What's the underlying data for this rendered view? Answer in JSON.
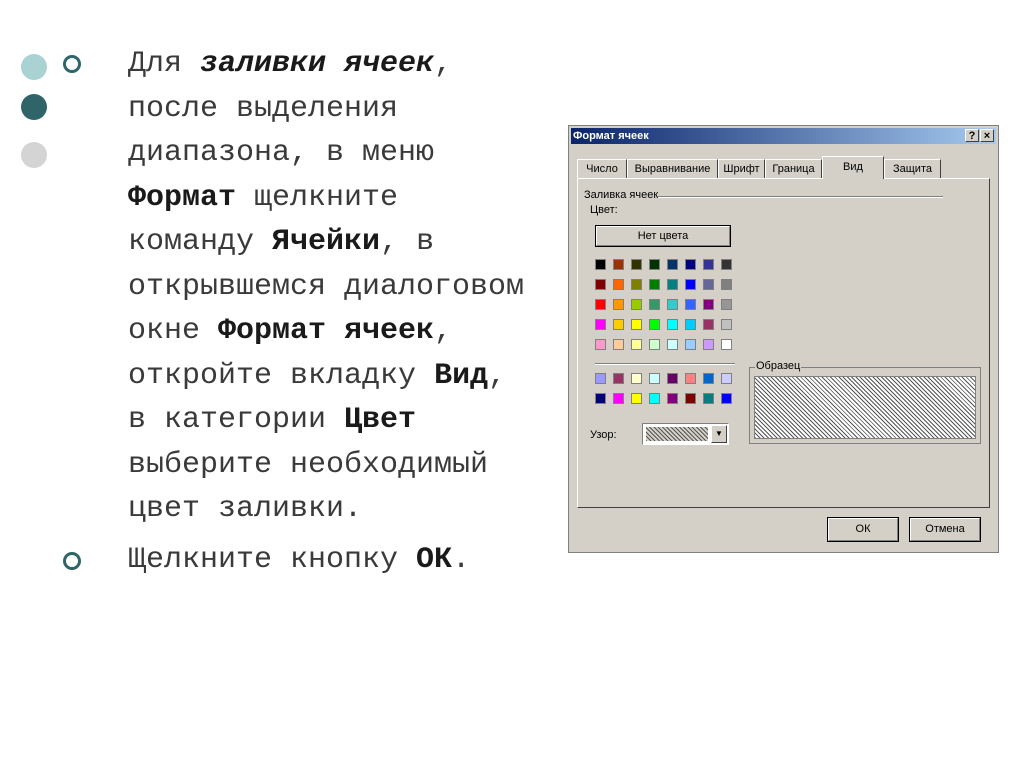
{
  "slide": {
    "bullet1": {
      "t1": "Для ",
      "b1": "заливки ячеек",
      "t2": ", после выделения диапазона, в меню ",
      "b2": "Формат",
      "t3": " щелкните команду ",
      "b3": "Ячейки",
      "t4": ", в открывшемся диалоговом окне ",
      "b4": "Формат ячеек",
      "t5": ", откройте вкладку ",
      "b5": "Вид",
      "t6": ", в категории ",
      "b6": "Цвет",
      "t7": " выберите необходимый цвет заливки."
    },
    "bullet2": {
      "t1": "Щелкните кнопку ",
      "b1": "ОК",
      "t2": "."
    }
  },
  "dialog": {
    "title": "Формат ячеек",
    "help_label": "?",
    "close_label": "×",
    "tabs": [
      {
        "label": "Число"
      },
      {
        "label": "Выравнивание"
      },
      {
        "label": "Шрифт"
      },
      {
        "label": "Граница"
      },
      {
        "label": "Вид"
      },
      {
        "label": "Защита"
      }
    ],
    "active_tab": "Вид",
    "group_label": "Заливка ячеек",
    "color_label": "Цвет:",
    "no_color_button": "Нет цвета",
    "palette_main": [
      "#000000",
      "#993300",
      "#333300",
      "#003300",
      "#003366",
      "#000080",
      "#333399",
      "#333333",
      "#800000",
      "#FF6600",
      "#808000",
      "#008000",
      "#008080",
      "#0000FF",
      "#666699",
      "#808080",
      "#FF0000",
      "#FF9900",
      "#99CC00",
      "#339966",
      "#33CCCC",
      "#3366FF",
      "#800080",
      "#969696",
      "#FF00FF",
      "#FFCC00",
      "#FFFF00",
      "#00FF00",
      "#00FFFF",
      "#00CCFF",
      "#993366",
      "#C0C0C0",
      "#FF99CC",
      "#FFCC99",
      "#FFFF99",
      "#CCFFCC",
      "#CCFFFF",
      "#99CCFF",
      "#CC99FF",
      "#FFFFFF"
    ],
    "palette_extra": [
      "#9999FF",
      "#993366",
      "#FFFFCC",
      "#CCFFFF",
      "#660066",
      "#FF8080",
      "#0066CC",
      "#CCCCFF",
      "#000080",
      "#FF00FF",
      "#FFFF00",
      "#00FFFF",
      "#800080",
      "#800000",
      "#008080",
      "#0000FF"
    ],
    "pattern_label": "Узор:",
    "sample_label": "Образец",
    "ok_button": "ОК",
    "cancel_button": "Отмена"
  },
  "colors": {
    "accent": "#2F6468",
    "deco_light": "#A9D3D3",
    "deco_gray": "#D4D4D4"
  }
}
